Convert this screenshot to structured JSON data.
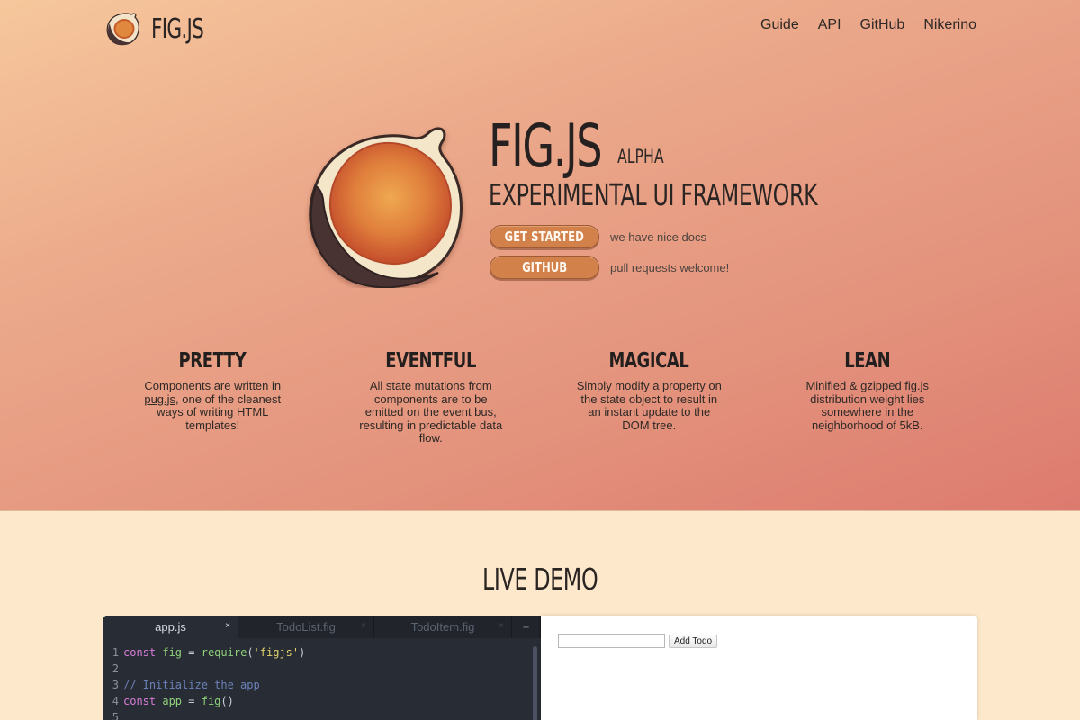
{
  "nav": {
    "brand": "FIG.JS",
    "links": [
      "Guide",
      "API",
      "GitHub",
      "Nikerino"
    ]
  },
  "hero": {
    "title": "FIG.JS",
    "badge": "ALPHA",
    "subtitle": "EXPERIMENTAL UI FRAMEWORK",
    "cta": [
      {
        "label": "GET STARTED",
        "note": "we have nice docs"
      },
      {
        "label": "GITHUB",
        "note": "pull requests welcome!"
      }
    ]
  },
  "features": [
    {
      "title": "PRETTY",
      "link": "pug.js",
      "text": ", one of the cleanest ways of writing HTML templates!",
      "prefix": "Components are written in "
    },
    {
      "title": "EVENTFUL",
      "text": "All state mutations from components are to be emitted on the event bus, resulting in predictable data flow."
    },
    {
      "title": "MAGICAL",
      "text": "Simply modify a property on the state object to result in an instant update to the DOM tree."
    },
    {
      "title": "LEAN",
      "text": "Minified & gzipped fig.js distribution weight lies somewhere in the neighborhood of 5kB."
    }
  ],
  "demo": {
    "title": "LIVE DEMO",
    "tabs": [
      "app.js",
      "TodoList.fig",
      "TodoItem.fig"
    ],
    "add_tab": "+",
    "close_glyph": "×",
    "code": [
      {
        "n": "1",
        "parts": [
          [
            "kw",
            "const"
          ],
          [
            "pn",
            " "
          ],
          [
            "var",
            "fig"
          ],
          [
            "op",
            " = "
          ],
          [
            "fn",
            "require"
          ],
          [
            "pn",
            "("
          ],
          [
            "str",
            "'figjs'"
          ],
          [
            "pn",
            ")"
          ]
        ]
      },
      {
        "n": "2",
        "parts": []
      },
      {
        "n": "3",
        "parts": [
          [
            "cm",
            "// Initialize the app"
          ]
        ]
      },
      {
        "n": "4",
        "parts": [
          [
            "kw",
            "const"
          ],
          [
            "pn",
            " "
          ],
          [
            "var",
            "app"
          ],
          [
            "op",
            " = "
          ],
          [
            "fn",
            "fig"
          ],
          [
            "pn",
            "()"
          ]
        ]
      },
      {
        "n": "5",
        "parts": []
      }
    ],
    "add_button": "Add Todo",
    "input_value": ""
  },
  "colors": {
    "hero_start": "#f6c79c",
    "hero_end": "#dd7a6f",
    "page_bg": "#fde8cb",
    "button": "#d2814b",
    "editor_bg": "#282c34"
  }
}
